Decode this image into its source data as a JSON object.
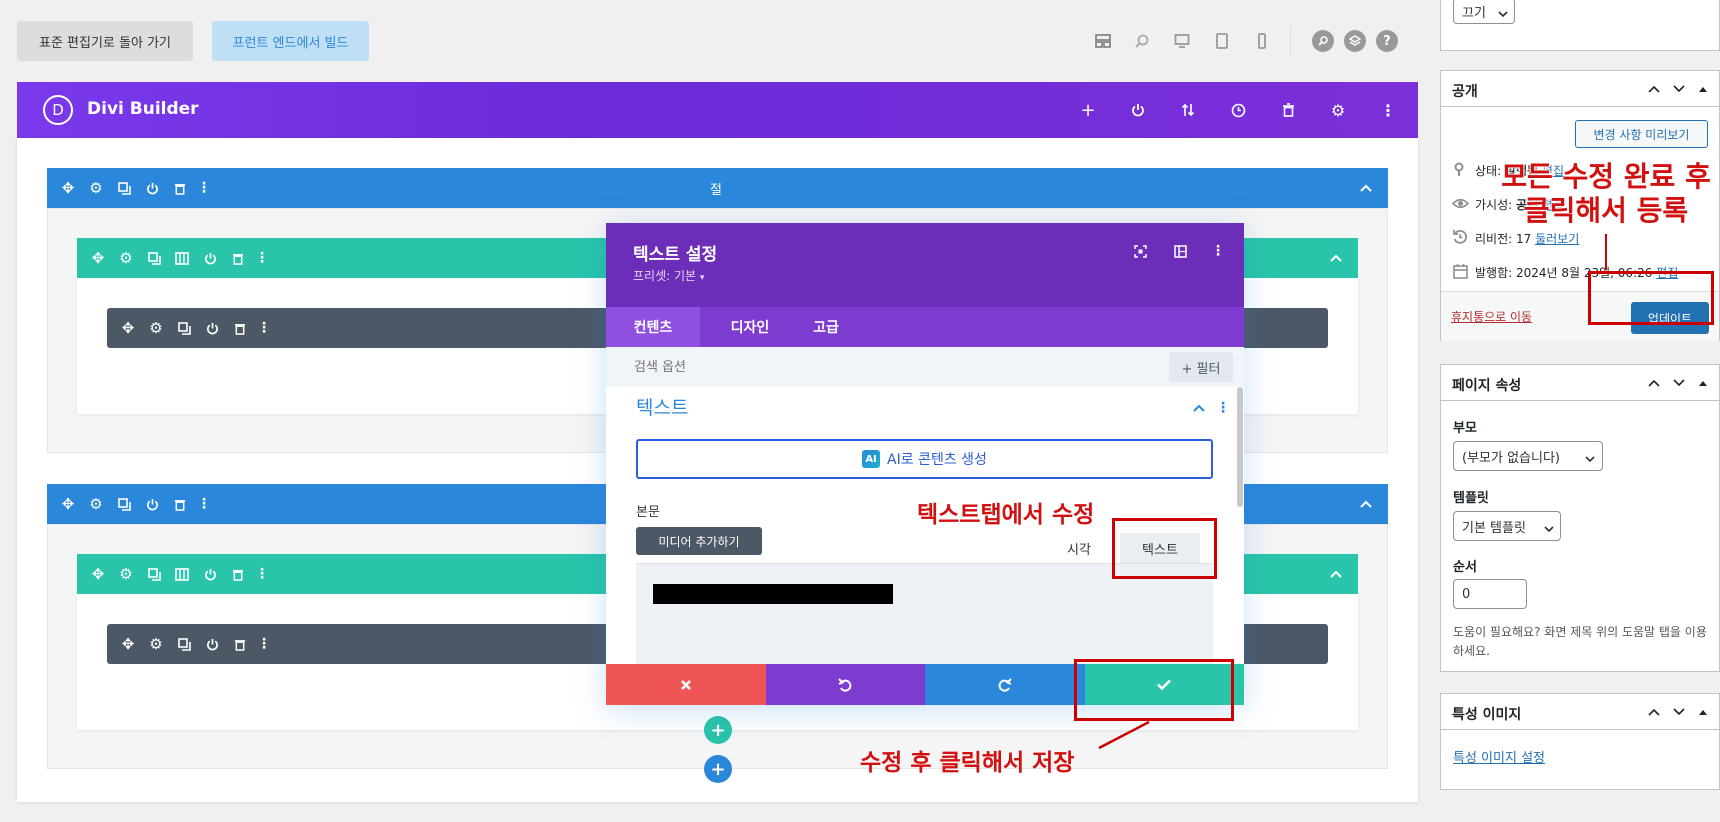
{
  "topbar": {
    "back_button": "표준 편집기로 돌아 가기",
    "frontend_button": "프런트 엔드에서 빌드",
    "icons": [
      "layout-icon",
      "zoom-icon",
      "desktop-icon",
      "tablet-icon",
      "phone-icon",
      "search-icon",
      "layers-icon",
      "help-icon"
    ]
  },
  "builder": {
    "logo_letter": "D",
    "title": "Divi Builder",
    "header_icons": [
      "add-icon",
      "power-icon",
      "sort-icon",
      "history-icon",
      "trash-icon",
      "gear-icon",
      "more-icon"
    ],
    "section1_label": "절"
  },
  "modal": {
    "title": "텍스트 설정",
    "preset": "프리셋: 기본",
    "tabs": [
      "컨텐츠",
      "디자인",
      "고급"
    ],
    "search_placeholder": "검색 옵션",
    "filter_label": "+ 필터",
    "group_title": "텍스트",
    "ai_button": "AI로 콘텐츠 생성",
    "ai_badge": "AI",
    "body_label": "본문",
    "media_button": "미디어 추가하기",
    "editor_tabs": [
      "시각",
      "텍스트"
    ]
  },
  "sidebar": {
    "top_select": "끄기",
    "publish": {
      "title": "공개",
      "preview_button": "변경 사항 미리보기",
      "status_label": "상태:",
      "status_value": "발행됨",
      "status_edit": "편집",
      "visibility_label": "가시성:",
      "visibility_value": "공개",
      "visibility_edit": "편집",
      "revisions_label": "리비전: 17",
      "revisions_link": "둘러보기",
      "published_label": "발행함: 2024년 8월 23일, 06:26",
      "published_edit": "편집",
      "trash_link": "휴지통으로 이동",
      "update_button": "업데이트"
    },
    "page_attributes": {
      "title": "페이지 속성",
      "parent_label": "부모",
      "parent_value": "(부모가 없습니다)",
      "template_label": "템플릿",
      "template_value": "기본 템플릿",
      "order_label": "순서",
      "order_value": "0",
      "help_text": "도움이 필요해요? 화면 제목 위의 도움말 탭을 이용하세요."
    },
    "featured_image": {
      "title": "특성 이미지",
      "set_link": "특성 이미지 설정"
    }
  },
  "annotations": {
    "register_note": "모든 수정 완료 후 클릭해서 등록",
    "text_tab_note": "텍스트탭에서 수정",
    "save_note": "수정 후 클릭해서 저장"
  },
  "colors": {
    "divi_purple": "#6c2eb9",
    "section_blue": "#2b87da",
    "row_green": "#29c4a9",
    "module_gray": "#4c5866",
    "annotation_red": "#d21010",
    "wp_blue": "#2271b1"
  }
}
